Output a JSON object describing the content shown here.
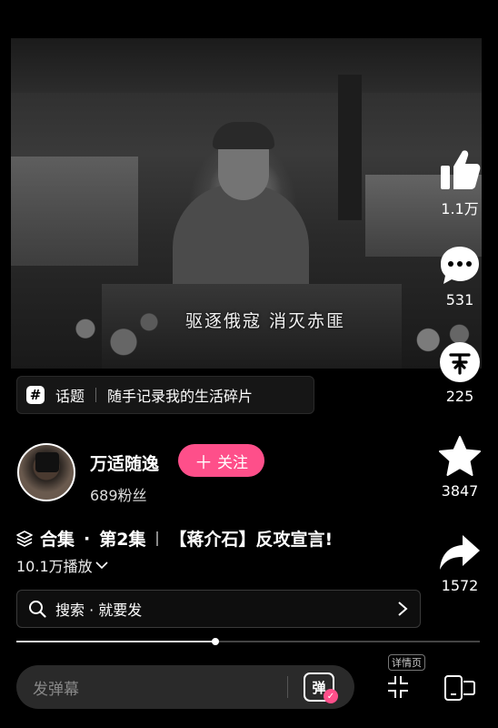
{
  "video": {
    "subtitle": "驱逐俄寇  消灭赤匪"
  },
  "topic": {
    "label": "话题",
    "text": "随手记录我的生活碎片"
  },
  "author": {
    "name": "万适随逸",
    "fans": "689粉丝",
    "follow_label": "关注"
  },
  "collection": {
    "label": "合集",
    "dot": "·",
    "episode": "第2集",
    "title": "【蒋介石】反攻宣言!"
  },
  "plays": "10.1万播放",
  "search": {
    "text": "搜索 · 就要发"
  },
  "progress": {
    "fraction": 0.43
  },
  "danmu": {
    "placeholder": "发弹幕",
    "button": "弹"
  },
  "detail_tag": "详情页",
  "actions": {
    "like": "1.1万",
    "comment": "531",
    "coin": "225",
    "favorite": "3847",
    "share": "1572"
  },
  "icons": [
    "like-icon",
    "comment-icon",
    "coin-icon",
    "star-icon",
    "share-icon",
    "search-icon",
    "chevron-right-icon",
    "collection-stack-icon",
    "shrink-icon",
    "device-switch-icon"
  ],
  "colors": {
    "accent": "#fe4f8a",
    "background": "#000000"
  }
}
